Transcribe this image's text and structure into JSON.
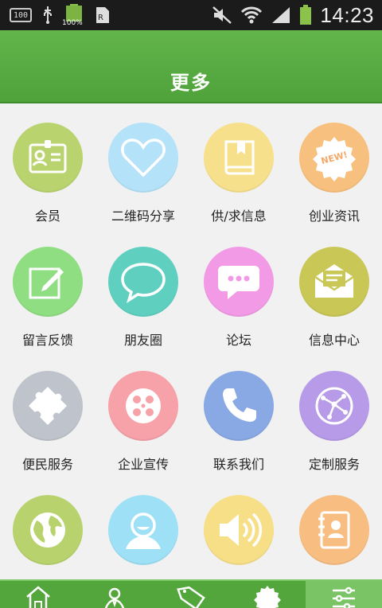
{
  "status_bar": {
    "battery_badge": "100",
    "battery_percent": "100%",
    "time": "14:23",
    "icons": [
      "storage-icon",
      "usb-icon",
      "battery-charging-icon",
      "sim-icon",
      "mute-icon",
      "wifi-icon",
      "signal-icon",
      "battery-icon"
    ]
  },
  "header": {
    "title": "更多"
  },
  "grid": {
    "items": [
      {
        "label": "会员",
        "icon": "member-card-icon",
        "color": "#b9d36f"
      },
      {
        "label": "二维码分享",
        "icon": "heart-icon",
        "color": "#b4e2f8"
      },
      {
        "label": "供/求信息",
        "icon": "book-icon",
        "color": "#f7e08c"
      },
      {
        "label": "创业资讯",
        "icon": "new-badge-icon",
        "color": "#f8c07e"
      },
      {
        "label": "留言反馈",
        "icon": "edit-note-icon",
        "color": "#8fde82"
      },
      {
        "label": "朋友圈",
        "icon": "chat-bubble-icon",
        "color": "#5fd0c0"
      },
      {
        "label": "论坛",
        "icon": "forum-bubble-icon",
        "color": "#f39ae6"
      },
      {
        "label": "信息中心",
        "icon": "envelope-icon",
        "color": "#c9c755"
      },
      {
        "label": "便民服务",
        "icon": "puzzle-icon",
        "color": "#bfc4cc"
      },
      {
        "label": "企业宣传",
        "icon": "film-reel-icon",
        "color": "#f7a1a9"
      },
      {
        "label": "联系我们",
        "icon": "phone-icon",
        "color": "#88a9e4"
      },
      {
        "label": "定制服务",
        "icon": "network-globe-icon",
        "color": "#b79be8"
      },
      {
        "label": "",
        "icon": "globe-icon",
        "color": "#b8d36e"
      },
      {
        "label": "",
        "icon": "user-smile-icon",
        "color": "#9ee0f6"
      },
      {
        "label": "",
        "icon": "speaker-icon",
        "color": "#f7df88"
      },
      {
        "label": "",
        "icon": "contacts-book-icon",
        "color": "#f8bd80"
      }
    ]
  },
  "tabbar": {
    "tabs": [
      {
        "icon": "home-icon",
        "active": false
      },
      {
        "icon": "tag-person-icon",
        "active": false
      },
      {
        "icon": "sale-tag-icon",
        "active": false
      },
      {
        "icon": "new-badge-icon",
        "active": false
      },
      {
        "icon": "settings-sliders-icon",
        "active": true
      }
    ]
  }
}
